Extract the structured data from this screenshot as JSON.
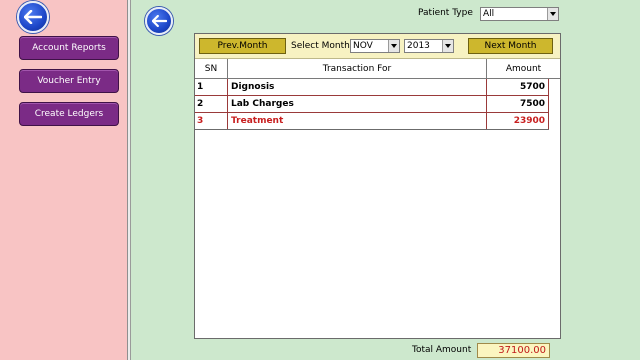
{
  "sidebar": {
    "back_icon": "arrow-left-icon",
    "buttons": [
      {
        "label": "Account Reports"
      },
      {
        "label": "Voucher Entry"
      },
      {
        "label": "Create Ledgers"
      }
    ]
  },
  "main": {
    "back_icon": "arrow-left-icon"
  },
  "filter": {
    "patient_type_label": "Patient Type",
    "patient_type_value": "All"
  },
  "toolbar": {
    "prev_label": "Prev.Month",
    "select_month_label": "Select Month",
    "month_value": "NOV",
    "year_value": "2013",
    "next_label": "Next Month"
  },
  "table": {
    "columns": [
      "SN",
      "Transaction For",
      "Amount"
    ],
    "rows": [
      {
        "sn": "1",
        "transaction": "Dignosis",
        "amount": "5700",
        "color": "#000000"
      },
      {
        "sn": "2",
        "transaction": "Lab Charges",
        "amount": "7500",
        "color": "#000000"
      },
      {
        "sn": "3",
        "transaction": "Treatment",
        "amount": "23900",
        "color": "#c81f1f"
      }
    ]
  },
  "total": {
    "label": "Total Amount",
    "value": "37100.00"
  },
  "colors": {
    "background": "#cde8cd",
    "sidebar": "#f8c4c4",
    "sidebar_button": "#7b2b86",
    "toolbar": "#f7f2c2",
    "yellow_button": "#cdb72d",
    "highlight_text": "#c81f1f"
  }
}
